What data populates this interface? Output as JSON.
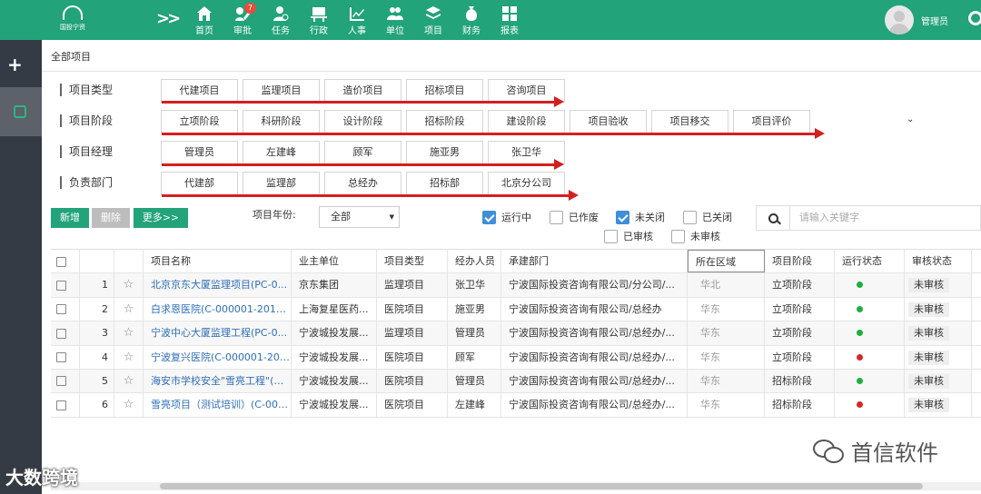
{
  "app": {
    "logo_text": "国投宁资",
    "collapse_icon": "double-chevron-right-icon"
  },
  "nav": [
    {
      "label": "首页",
      "icon": "home-icon"
    },
    {
      "label": "审批",
      "icon": "approve-pen-icon",
      "badge": "7"
    },
    {
      "label": "任务",
      "icon": "task-user-icon"
    },
    {
      "label": "行政",
      "icon": "desk-icon"
    },
    {
      "label": "人事",
      "icon": "chart-line-icon"
    },
    {
      "label": "单位",
      "icon": "people-icon"
    },
    {
      "label": "项目",
      "icon": "layers-icon"
    },
    {
      "label": "财务",
      "icon": "money-bag-icon"
    },
    {
      "label": "报表",
      "icon": "grid-icon"
    }
  ],
  "user": {
    "name": "管理员"
  },
  "breadcrumb": "全部项目",
  "filters": [
    {
      "label": "项目类型",
      "options": [
        "代建项目",
        "监理项目",
        "造价项目",
        "招标项目",
        "咨询项目"
      ]
    },
    {
      "label": "项目阶段",
      "options": [
        "立项阶段",
        "科研阶段",
        "设计阶段",
        "招标阶段",
        "建设阶段",
        "项目验收",
        "项目移交",
        "项目评价"
      ]
    },
    {
      "label": "项目经理",
      "options": [
        "管理员",
        "左建峰",
        "顾军",
        "施亚男",
        "张卫华"
      ]
    },
    {
      "label": "负责部门",
      "options": [
        "代建部",
        "监理部",
        "总经办",
        "招标部",
        "北京分公司"
      ]
    }
  ],
  "toolbar": {
    "new_label": "新增",
    "delete_label": "删除",
    "more_label": "更多>>",
    "year_label": "项目年份:",
    "year_value": "全部",
    "checkboxes": [
      {
        "label": "运行中",
        "checked": true
      },
      {
        "label": "已作废",
        "checked": false
      },
      {
        "label": "未关闭",
        "checked": true
      },
      {
        "label": "已关闭",
        "checked": false
      },
      {
        "label": "已审核",
        "checked": false
      },
      {
        "label": "未审核",
        "checked": false
      }
    ],
    "search_placeholder": "请输入关键字"
  },
  "table": {
    "columns": [
      "项目名称",
      "业主单位",
      "项目类型",
      "经办人员",
      "承建部门",
      "所在区域",
      "项目阶段",
      "运行状态",
      "审核状态"
    ],
    "rows": [
      {
        "no": "1",
        "name": "北京京东大厦监理项目(PC-0...",
        "owner": "京东集团",
        "type": "监理项目",
        "person": "张卫华",
        "dept": "宁波国际投资咨询有限公司/分公司/...",
        "region": "华北",
        "stage": "立项阶段",
        "status_color": "#1fae3f",
        "audit": "未审核"
      },
      {
        "no": "2",
        "name": "白求恩医院(C-000001-20190...",
        "owner": "上海复星医药...",
        "type": "医院项目",
        "person": "施亚男",
        "dept": "宁波国际投资咨询有限公司/总经办",
        "region": "华东",
        "stage": "立项阶段",
        "status_color": "#1fae3f",
        "audit": "未审核"
      },
      {
        "no": "3",
        "name": "宁波中心大厦监理工程(PC-0...",
        "owner": "宁波城投发展...",
        "type": "监理项目",
        "person": "管理员",
        "dept": "宁波国际投资咨询有限公司/总经办/...",
        "region": "华东",
        "stage": "立项阶段",
        "status_color": "#1fae3f",
        "audit": "未审核"
      },
      {
        "no": "4",
        "name": "宁波复兴医院(C-000001-201...",
        "owner": "宁波城投发展...",
        "type": "医院项目",
        "person": "顾军",
        "dept": "宁波国际投资咨询有限公司/总经办/...",
        "region": "华东",
        "stage": "立项阶段",
        "status_color": "#d62828",
        "audit": "未审核"
      },
      {
        "no": "5",
        "name": "海安市学校安全\"雪亮工程\"(C-...",
        "owner": "宁波城投发展...",
        "type": "医院项目",
        "person": "管理员",
        "dept": "宁波国际投资咨询有限公司/总经办/...",
        "region": "华东",
        "stage": "招标阶段",
        "status_color": "#1fae3f",
        "audit": "未审核"
      },
      {
        "no": "6",
        "name": "雪亮项目（测试培训）(C-000...",
        "owner": "宁波城投发展...",
        "type": "医院项目",
        "person": "左建峰",
        "dept": "宁波国际投资咨询有限公司/总经办/...",
        "region": "华东",
        "stage": "招标阶段",
        "status_color": "#d62828",
        "audit": "未审核"
      }
    ]
  },
  "watermarks": {
    "wechat": "首信软件",
    "bottom": "大数跨境"
  }
}
